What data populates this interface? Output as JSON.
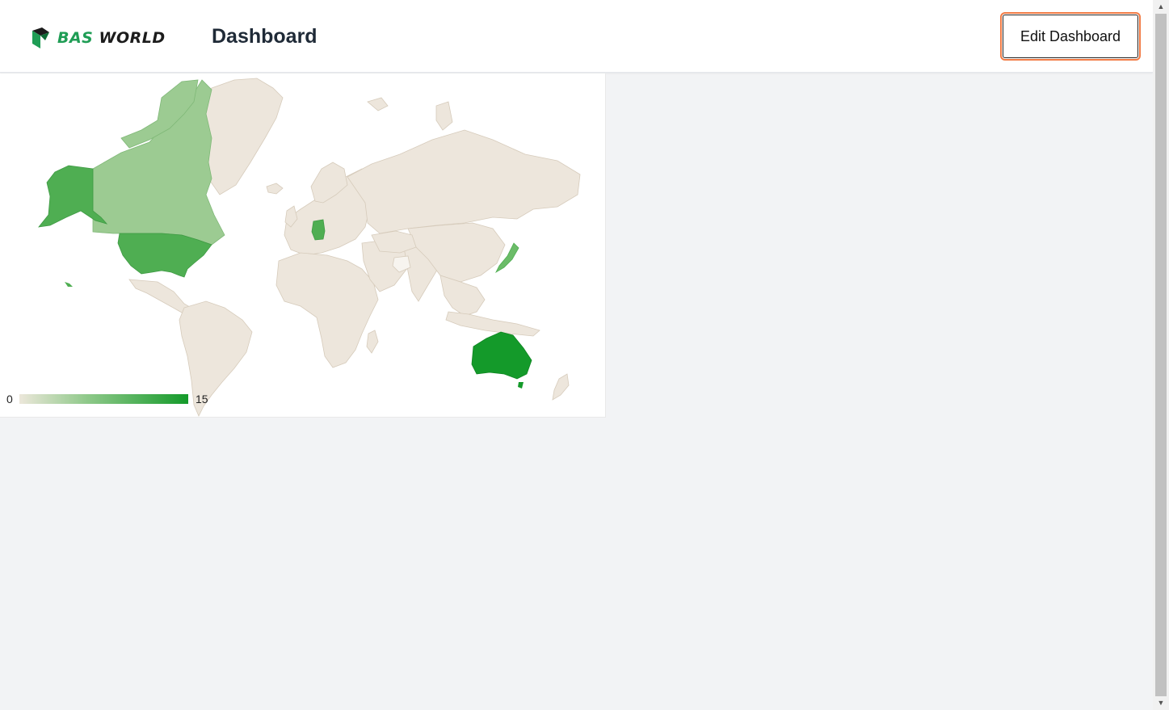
{
  "header": {
    "logo": {
      "brand_part1": "BAS",
      "brand_part2": "WORLD"
    },
    "title": "Dashboard",
    "edit_button_label": "Edit Dashboard"
  },
  "map": {
    "legend": {
      "min": "0",
      "max": "15"
    },
    "colors": {
      "empty": "#ece6dc",
      "low": "#9ccb92",
      "mid": "#4fae52",
      "high": "#149a2a"
    },
    "highlighted_regions": [
      "Canada",
      "United States",
      "Alaska",
      "Germany",
      "Japan",
      "Australia"
    ]
  }
}
